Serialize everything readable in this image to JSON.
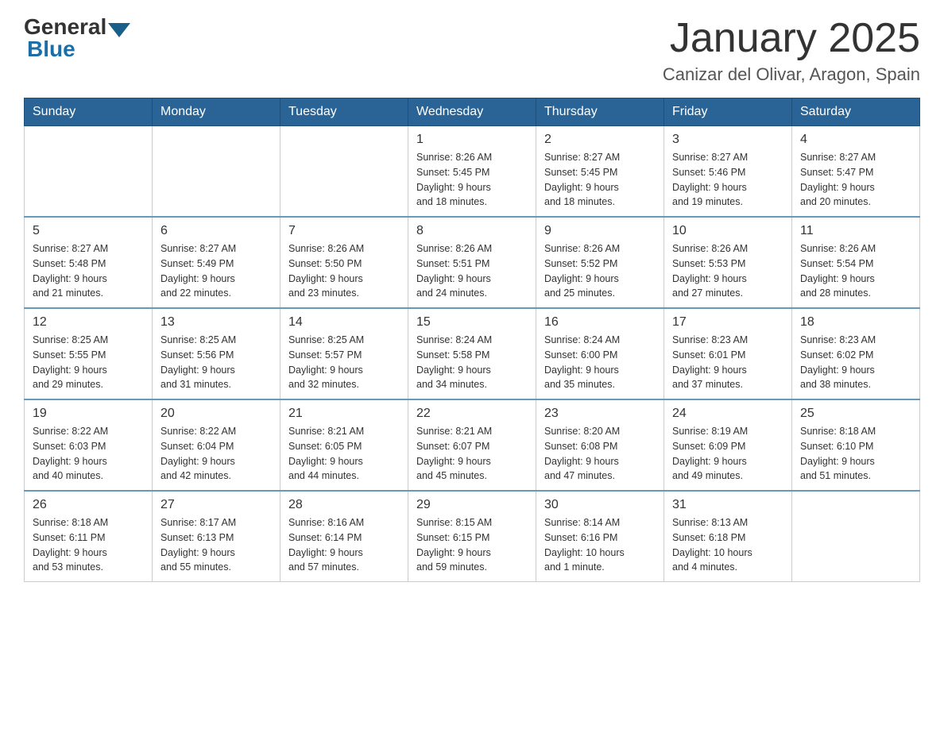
{
  "header": {
    "logo_general": "General",
    "logo_blue": "Blue",
    "month_title": "January 2025",
    "location": "Canizar del Olivar, Aragon, Spain"
  },
  "weekdays": [
    "Sunday",
    "Monday",
    "Tuesday",
    "Wednesday",
    "Thursday",
    "Friday",
    "Saturday"
  ],
  "weeks": [
    [
      {
        "day": "",
        "info": ""
      },
      {
        "day": "",
        "info": ""
      },
      {
        "day": "",
        "info": ""
      },
      {
        "day": "1",
        "info": "Sunrise: 8:26 AM\nSunset: 5:45 PM\nDaylight: 9 hours\nand 18 minutes."
      },
      {
        "day": "2",
        "info": "Sunrise: 8:27 AM\nSunset: 5:45 PM\nDaylight: 9 hours\nand 18 minutes."
      },
      {
        "day": "3",
        "info": "Sunrise: 8:27 AM\nSunset: 5:46 PM\nDaylight: 9 hours\nand 19 minutes."
      },
      {
        "day": "4",
        "info": "Sunrise: 8:27 AM\nSunset: 5:47 PM\nDaylight: 9 hours\nand 20 minutes."
      }
    ],
    [
      {
        "day": "5",
        "info": "Sunrise: 8:27 AM\nSunset: 5:48 PM\nDaylight: 9 hours\nand 21 minutes."
      },
      {
        "day": "6",
        "info": "Sunrise: 8:27 AM\nSunset: 5:49 PM\nDaylight: 9 hours\nand 22 minutes."
      },
      {
        "day": "7",
        "info": "Sunrise: 8:26 AM\nSunset: 5:50 PM\nDaylight: 9 hours\nand 23 minutes."
      },
      {
        "day": "8",
        "info": "Sunrise: 8:26 AM\nSunset: 5:51 PM\nDaylight: 9 hours\nand 24 minutes."
      },
      {
        "day": "9",
        "info": "Sunrise: 8:26 AM\nSunset: 5:52 PM\nDaylight: 9 hours\nand 25 minutes."
      },
      {
        "day": "10",
        "info": "Sunrise: 8:26 AM\nSunset: 5:53 PM\nDaylight: 9 hours\nand 27 minutes."
      },
      {
        "day": "11",
        "info": "Sunrise: 8:26 AM\nSunset: 5:54 PM\nDaylight: 9 hours\nand 28 minutes."
      }
    ],
    [
      {
        "day": "12",
        "info": "Sunrise: 8:25 AM\nSunset: 5:55 PM\nDaylight: 9 hours\nand 29 minutes."
      },
      {
        "day": "13",
        "info": "Sunrise: 8:25 AM\nSunset: 5:56 PM\nDaylight: 9 hours\nand 31 minutes."
      },
      {
        "day": "14",
        "info": "Sunrise: 8:25 AM\nSunset: 5:57 PM\nDaylight: 9 hours\nand 32 minutes."
      },
      {
        "day": "15",
        "info": "Sunrise: 8:24 AM\nSunset: 5:58 PM\nDaylight: 9 hours\nand 34 minutes."
      },
      {
        "day": "16",
        "info": "Sunrise: 8:24 AM\nSunset: 6:00 PM\nDaylight: 9 hours\nand 35 minutes."
      },
      {
        "day": "17",
        "info": "Sunrise: 8:23 AM\nSunset: 6:01 PM\nDaylight: 9 hours\nand 37 minutes."
      },
      {
        "day": "18",
        "info": "Sunrise: 8:23 AM\nSunset: 6:02 PM\nDaylight: 9 hours\nand 38 minutes."
      }
    ],
    [
      {
        "day": "19",
        "info": "Sunrise: 8:22 AM\nSunset: 6:03 PM\nDaylight: 9 hours\nand 40 minutes."
      },
      {
        "day": "20",
        "info": "Sunrise: 8:22 AM\nSunset: 6:04 PM\nDaylight: 9 hours\nand 42 minutes."
      },
      {
        "day": "21",
        "info": "Sunrise: 8:21 AM\nSunset: 6:05 PM\nDaylight: 9 hours\nand 44 minutes."
      },
      {
        "day": "22",
        "info": "Sunrise: 8:21 AM\nSunset: 6:07 PM\nDaylight: 9 hours\nand 45 minutes."
      },
      {
        "day": "23",
        "info": "Sunrise: 8:20 AM\nSunset: 6:08 PM\nDaylight: 9 hours\nand 47 minutes."
      },
      {
        "day": "24",
        "info": "Sunrise: 8:19 AM\nSunset: 6:09 PM\nDaylight: 9 hours\nand 49 minutes."
      },
      {
        "day": "25",
        "info": "Sunrise: 8:18 AM\nSunset: 6:10 PM\nDaylight: 9 hours\nand 51 minutes."
      }
    ],
    [
      {
        "day": "26",
        "info": "Sunrise: 8:18 AM\nSunset: 6:11 PM\nDaylight: 9 hours\nand 53 minutes."
      },
      {
        "day": "27",
        "info": "Sunrise: 8:17 AM\nSunset: 6:13 PM\nDaylight: 9 hours\nand 55 minutes."
      },
      {
        "day": "28",
        "info": "Sunrise: 8:16 AM\nSunset: 6:14 PM\nDaylight: 9 hours\nand 57 minutes."
      },
      {
        "day": "29",
        "info": "Sunrise: 8:15 AM\nSunset: 6:15 PM\nDaylight: 9 hours\nand 59 minutes."
      },
      {
        "day": "30",
        "info": "Sunrise: 8:14 AM\nSunset: 6:16 PM\nDaylight: 10 hours\nand 1 minute."
      },
      {
        "day": "31",
        "info": "Sunrise: 8:13 AM\nSunset: 6:18 PM\nDaylight: 10 hours\nand 4 minutes."
      },
      {
        "day": "",
        "info": ""
      }
    ]
  ]
}
